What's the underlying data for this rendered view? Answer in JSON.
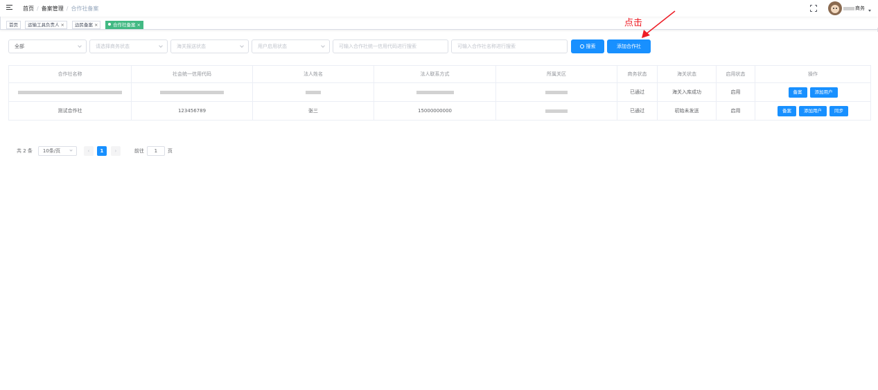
{
  "breadcrumb": {
    "home": "首页",
    "section": "备案管理",
    "current": "合作社备案"
  },
  "user": {
    "name_suffix": "商务"
  },
  "tags": [
    {
      "label": "首页"
    },
    {
      "label": "运输工具负责人"
    },
    {
      "label": "边民备案"
    },
    {
      "label": "合作社备案"
    }
  ],
  "filters": {
    "scope": "全部",
    "business_status": "请选择商务状态",
    "customs_status": "海关报送状态",
    "user_status": "用户启用状态",
    "credit_code": "可输入合作社统一信用代码进行搜索",
    "coop_name": "可输入合作社名称进行搜索"
  },
  "buttons": {
    "search": "搜索",
    "add_coop": "添加合作社"
  },
  "annotation": {
    "text": "点击",
    "color": "#ee1c25"
  },
  "table": {
    "headers": [
      "合作社名称",
      "社会统一信用代码",
      "法人姓名",
      "法人联系方式",
      "所属关区",
      "商务状态",
      "海关状态",
      "启用状态",
      "操作"
    ],
    "rows": [
      {
        "business_status": "已通过",
        "customs_status": "海关入库成功",
        "enable_status": "启用",
        "actions": [
          "备案",
          "添加用户"
        ]
      },
      {
        "name": "测试合作社",
        "credit_code": "123456789",
        "legal_name": "张三",
        "phone": "15000000000",
        "business_status": "已通过",
        "customs_status": "初始未发送",
        "enable_status": "启用",
        "actions": [
          "备案",
          "添加用户",
          "同步"
        ]
      }
    ]
  },
  "pagination": {
    "total": "共 2 条",
    "page_size": "10条/页",
    "current_page": "1",
    "goto_label": "前往",
    "goto_value": "1",
    "goto_suffix": "页"
  },
  "colors": {
    "primary": "#1890ff",
    "active_tag": "#42b983"
  }
}
